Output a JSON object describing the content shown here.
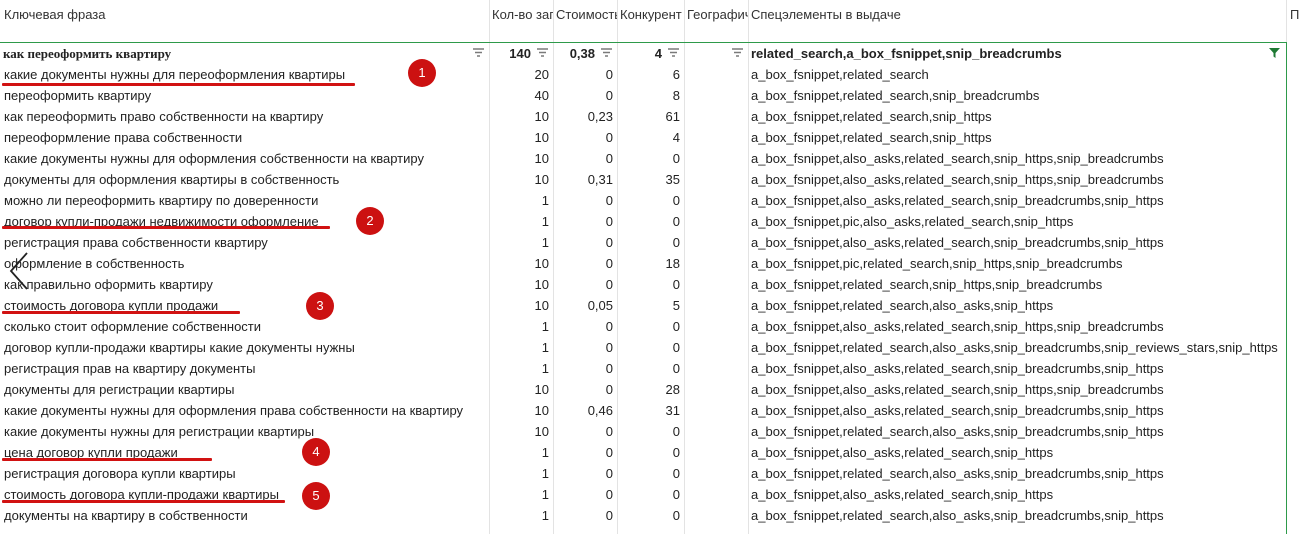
{
  "header": {
    "col_phrase": "Ключевая фраза",
    "col_count": "Кол-во заг",
    "col_cost": "Стоимость",
    "col_competition": "Конкурент",
    "col_geo": "Географич",
    "col_special": "Спецэлементы в выдаче",
    "col_extra": "П"
  },
  "summary": {
    "phrase": "как переоформить квартиру",
    "count": "140",
    "cost": "0,38",
    "competition": "4",
    "geo": "",
    "special": "related_search,a_box_fsnippet,snip_breadcrumbs"
  },
  "rows": [
    {
      "phrase": "какие документы нужны для переоформления квартиры",
      "count": "20",
      "cost": "0",
      "competition": "6",
      "special": "a_box_fsnippet,related_search"
    },
    {
      "phrase": "переоформить квартиру",
      "count": "40",
      "cost": "0",
      "competition": "8",
      "special": "a_box_fsnippet,related_search,snip_breadcrumbs"
    },
    {
      "phrase": "как переоформить право собственности на квартиру",
      "count": "10",
      "cost": "0,23",
      "competition": "61",
      "special": "a_box_fsnippet,related_search,snip_https"
    },
    {
      "phrase": "переоформление права собственности",
      "count": "10",
      "cost": "0",
      "competition": "4",
      "special": "a_box_fsnippet,related_search,snip_https"
    },
    {
      "phrase": "какие документы нужны для оформления собственности на квартиру",
      "count": "10",
      "cost": "0",
      "competition": "0",
      "special": "a_box_fsnippet,also_asks,related_search,snip_https,snip_breadcrumbs"
    },
    {
      "phrase": "документы для оформления квартиры в собственность",
      "count": "10",
      "cost": "0,31",
      "competition": "35",
      "special": "a_box_fsnippet,also_asks,related_search,snip_https,snip_breadcrumbs"
    },
    {
      "phrase": "можно ли переоформить квартиру по доверенности",
      "count": "1",
      "cost": "0",
      "competition": "0",
      "special": "a_box_fsnippet,also_asks,related_search,snip_breadcrumbs,snip_https"
    },
    {
      "phrase": "договор купли-продажи недвижимости оформление",
      "count": "1",
      "cost": "0",
      "competition": "0",
      "special": "a_box_fsnippet,pic,also_asks,related_search,snip_https"
    },
    {
      "phrase": "регистрация права собственности квартиру",
      "count": "1",
      "cost": "0",
      "competition": "0",
      "special": "a_box_fsnippet,also_asks,related_search,snip_breadcrumbs,snip_https"
    },
    {
      "phrase": "оформление в собственность",
      "count": "10",
      "cost": "0",
      "competition": "18",
      "special": "a_box_fsnippet,pic,related_search,snip_https,snip_breadcrumbs"
    },
    {
      "phrase": "как правильно оформить квартиру",
      "count": "10",
      "cost": "0",
      "competition": "0",
      "special": "a_box_fsnippet,related_search,snip_https,snip_breadcrumbs"
    },
    {
      "phrase": "стоимость договора купли продажи",
      "count": "10",
      "cost": "0,05",
      "competition": "5",
      "special": "a_box_fsnippet,related_search,also_asks,snip_https"
    },
    {
      "phrase": "сколько стоит оформление собственности",
      "count": "1",
      "cost": "0",
      "competition": "0",
      "special": "a_box_fsnippet,also_asks,related_search,snip_https,snip_breadcrumbs"
    },
    {
      "phrase": "договор купли-продажи квартиры какие документы нужны",
      "count": "1",
      "cost": "0",
      "competition": "0",
      "special": "a_box_fsnippet,related_search,also_asks,snip_breadcrumbs,snip_reviews_stars,snip_https"
    },
    {
      "phrase": "регистрация прав на квартиру документы",
      "count": "1",
      "cost": "0",
      "competition": "0",
      "special": "a_box_fsnippet,also_asks,related_search,snip_breadcrumbs,snip_https"
    },
    {
      "phrase": "документы для регистрации квартиры",
      "count": "10",
      "cost": "0",
      "competition": "28",
      "special": "a_box_fsnippet,also_asks,related_search,snip_https,snip_breadcrumbs"
    },
    {
      "phrase": "какие документы нужны для оформления права собственности на квартиру",
      "count": "10",
      "cost": "0,46",
      "competition": "31",
      "special": "a_box_fsnippet,also_asks,related_search,snip_breadcrumbs,snip_https"
    },
    {
      "phrase": "какие документы нужны для регистрации квартиры",
      "count": "10",
      "cost": "0",
      "competition": "0",
      "special": "a_box_fsnippet,related_search,also_asks,snip_breadcrumbs,snip_https"
    },
    {
      "phrase": "цена договор купли продажи",
      "count": "1",
      "cost": "0",
      "competition": "0",
      "special": "a_box_fsnippet,also_asks,related_search,snip_https"
    },
    {
      "phrase": "регистрация договора купли квартиры",
      "count": "1",
      "cost": "0",
      "competition": "0",
      "special": "a_box_fsnippet,related_search,also_asks,snip_breadcrumbs,snip_https"
    },
    {
      "phrase": "стоимость договора купли-продажи квартиры",
      "count": "1",
      "cost": "0",
      "competition": "0",
      "special": "a_box_fsnippet,also_asks,related_search,snip_https"
    },
    {
      "phrase": "документы на квартиру в собственности",
      "count": "1",
      "cost": "0",
      "competition": "0",
      "special": "a_box_fsnippet,related_search,also_asks,snip_breadcrumbs,snip_https"
    }
  ],
  "annotations": [
    {
      "number": "1"
    },
    {
      "number": "2"
    },
    {
      "number": "3"
    },
    {
      "number": "4"
    },
    {
      "number": "5"
    }
  ],
  "colors": {
    "annotation_red": "#cc1111",
    "table_border_green": "#2e9a4a",
    "filter_icon_gray": "#7a7a7a",
    "active_filter_green": "#1f7a34"
  },
  "icons": {
    "filter": "filter-icon",
    "active_filter": "filter-active-icon",
    "back": "chevron-left-icon"
  }
}
